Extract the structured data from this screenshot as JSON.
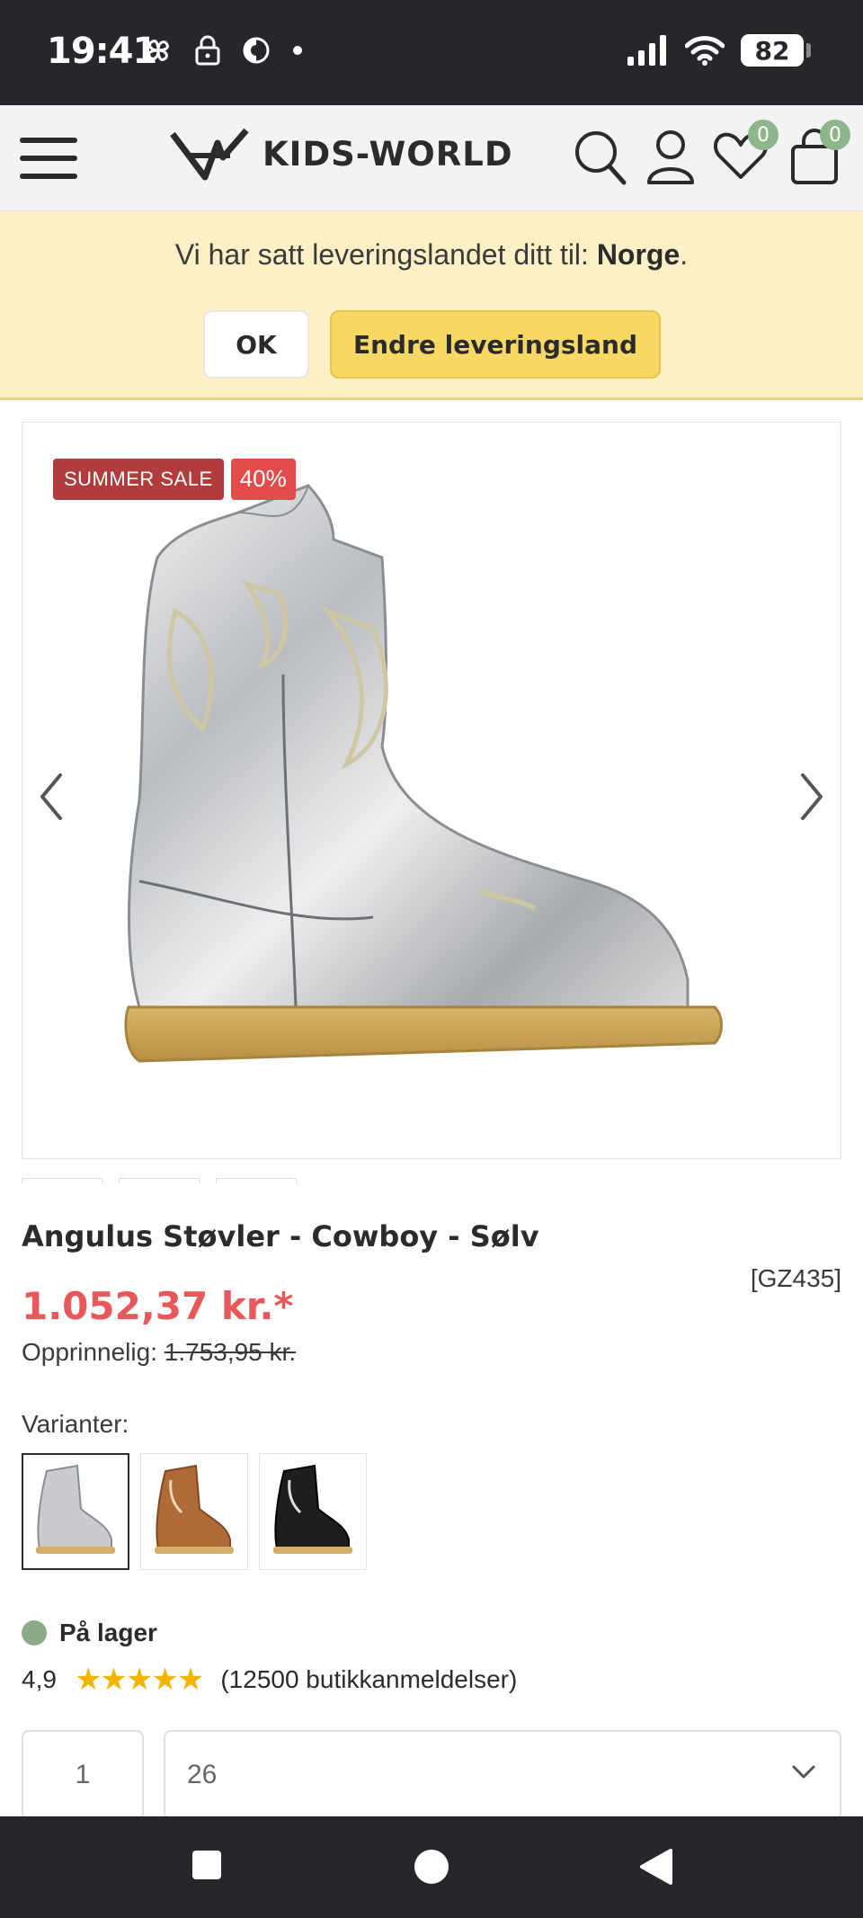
{
  "status_bar": {
    "time": "19:41",
    "battery": "82"
  },
  "header": {
    "logo_text": "KIDS-WORLD",
    "wishlist_count": "0",
    "cart_count": "0"
  },
  "delivery_banner": {
    "text": "Vi har satt leveringslandet ditt til: ",
    "country": "Norge",
    "suffix": ".",
    "ok_label": "OK",
    "change_label": "Endre leveringsland"
  },
  "product": {
    "sale_badge": "SUMMER SALE",
    "discount_badge": "40%",
    "title": "Angulus Støvler - Cowboy - Sølv",
    "sku": "[GZ435]",
    "price": "1.052,37 kr.*",
    "original_label": "Opprinnelig: ",
    "original_price": "1.753,95 kr.",
    "variants_label": "Varianter:",
    "variants": [
      {
        "name": "silver",
        "color": "#c9c9c9"
      },
      {
        "name": "cognac",
        "color": "#b06a37"
      },
      {
        "name": "black",
        "color": "#1e1e1e"
      }
    ],
    "stock_text": "På lager",
    "rating": "4,9",
    "stars": "★★★★★",
    "reviews": "(12500 butikkanmeldelser)",
    "quantity": "1",
    "size": "26"
  },
  "colors": {
    "price_red": "#e8585a",
    "banner_bg": "#fdefc6",
    "button_yellow": "#f7d865",
    "badge_green": "#8fb58a",
    "star_gold": "#f2b400"
  }
}
